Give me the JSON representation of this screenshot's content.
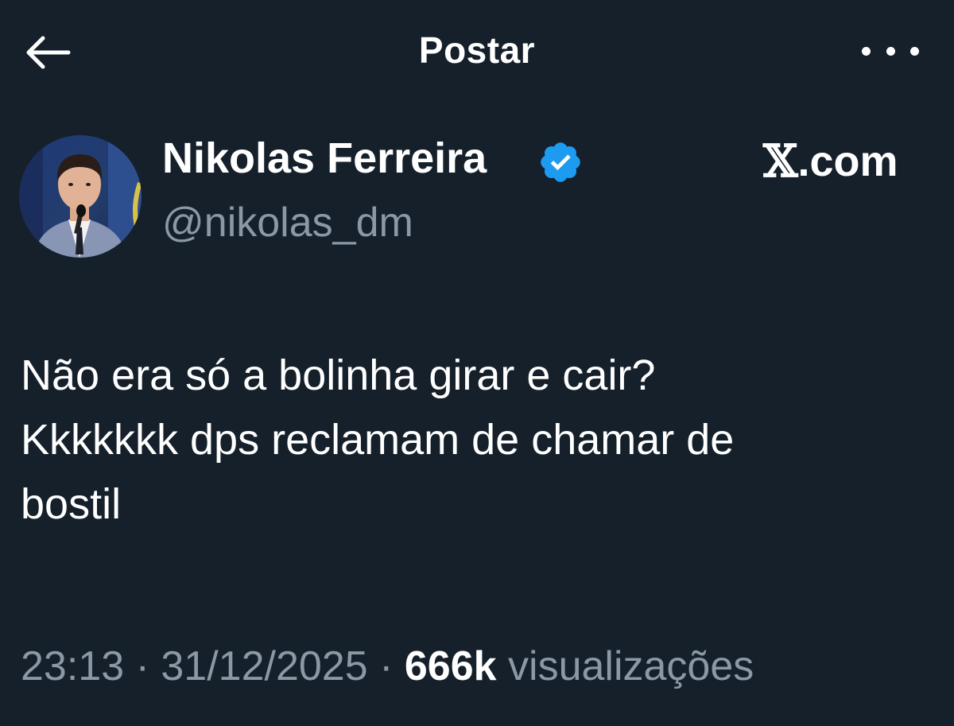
{
  "header": {
    "title": "Postar",
    "back_icon": "arrow-left-icon",
    "more_icon": "more-horizontal-icon"
  },
  "author": {
    "name": "Nikolas Ferreira",
    "handle": "@nikolas_dm",
    "verified": true,
    "verified_color": "#1d9bf0",
    "avatar_icon": "profile-photo"
  },
  "source_label": ".com",
  "source_logo": "x-logo-icon",
  "post": {
    "text": "Não era só a bolinha girar e cair?\nKkkkkkk dps reclamam de chamar de\nbostil"
  },
  "meta": {
    "time": "23:13",
    "separator": "·",
    "date": "31/12/2025",
    "views_count": "666k",
    "views_label": "visualizações"
  },
  "colors": {
    "background": "#15202b",
    "text": "#ffffff",
    "secondary_text": "#8b98a5"
  }
}
